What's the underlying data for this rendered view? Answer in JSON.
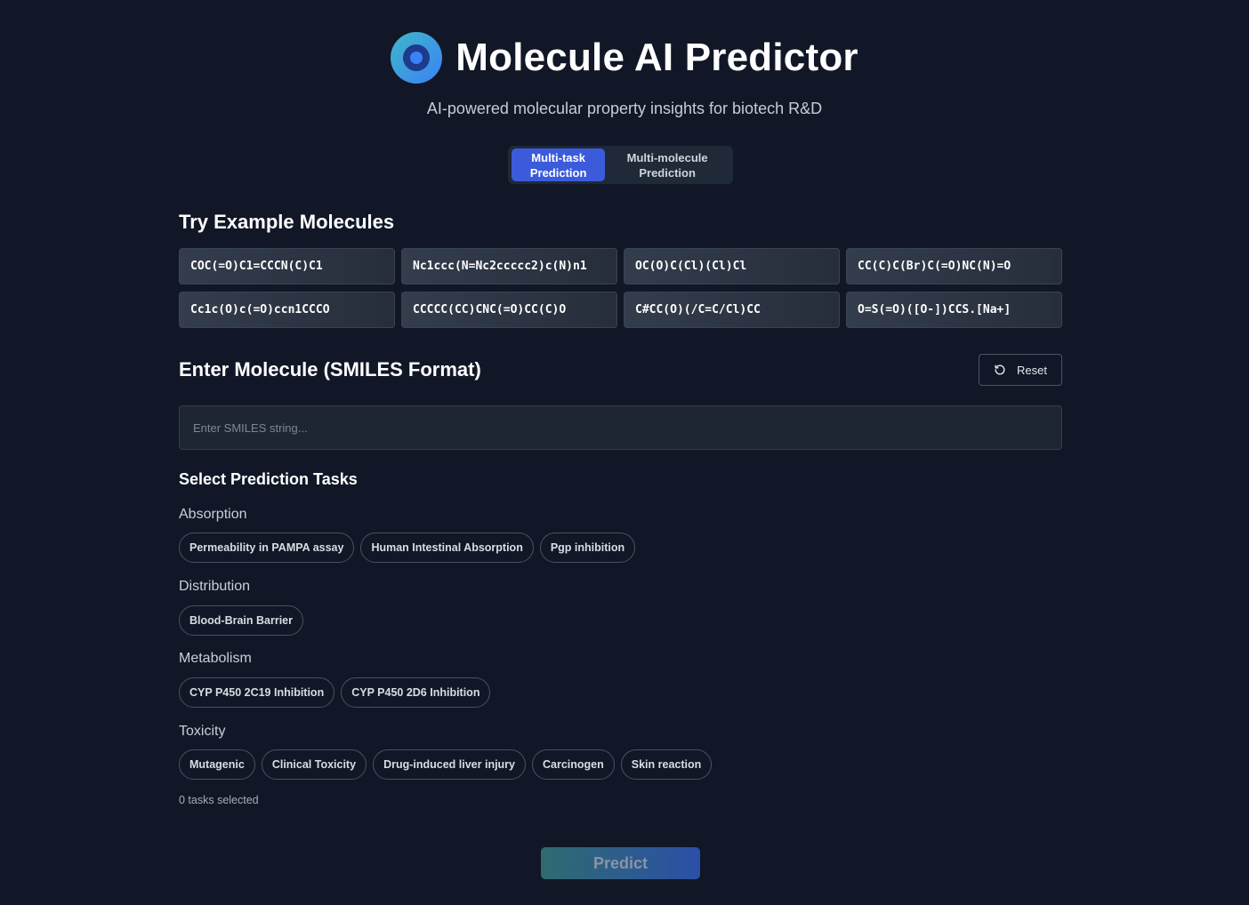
{
  "header": {
    "title": "Molecule AI Predictor",
    "subtitle": "AI-powered molecular property insights for biotech R&D",
    "logo_icon": "molecule-logo-icon"
  },
  "mode_tabs": [
    {
      "label": "Multi-task\nPrediction",
      "active": true
    },
    {
      "label": "Multi-molecule\nPrediction",
      "active": false
    }
  ],
  "examples": {
    "title": "Try Example Molecules",
    "items": [
      "COC(=O)C1=CCCN(C)C1",
      "Nc1ccc(N=Nc2ccccc2)c(N)n1",
      "OC(O)C(Cl)(Cl)Cl",
      "CC(C)C(Br)C(=O)NC(N)=O",
      "Cc1c(O)c(=O)ccn1CCCO",
      "CCCCC(CC)CNC(=O)CC(C)O",
      "C#CC(O)(/C=C/Cl)CC",
      "O=S(=O)([O-])CCS.[Na+]"
    ]
  },
  "input_section": {
    "title": "Enter Molecule (SMILES Format)",
    "reset_label": "Reset",
    "placeholder": "Enter SMILES string...",
    "value": ""
  },
  "tasks": {
    "title": "Select Prediction Tasks",
    "groups": [
      {
        "label": "Absorption",
        "chips": [
          "Permeability in PAMPA assay",
          "Human Intestinal Absorption",
          "Pgp inhibition"
        ]
      },
      {
        "label": "Distribution",
        "chips": [
          "Blood-Brain Barrier"
        ]
      },
      {
        "label": "Metabolism",
        "chips": [
          "CYP P450 2C19 Inhibition",
          "CYP P450 2D6 Inhibition"
        ]
      },
      {
        "label": "Toxicity",
        "chips": [
          "Mutagenic",
          "Clinical Toxicity",
          "Drug-induced liver injury",
          "Carcinogen",
          "Skin reaction"
        ]
      }
    ],
    "count_text": "0 tasks selected"
  },
  "predict_label": "Predict",
  "colors": {
    "background": "#111726",
    "accent": "#3b5bdb",
    "chip_border": "#4a5260"
  }
}
